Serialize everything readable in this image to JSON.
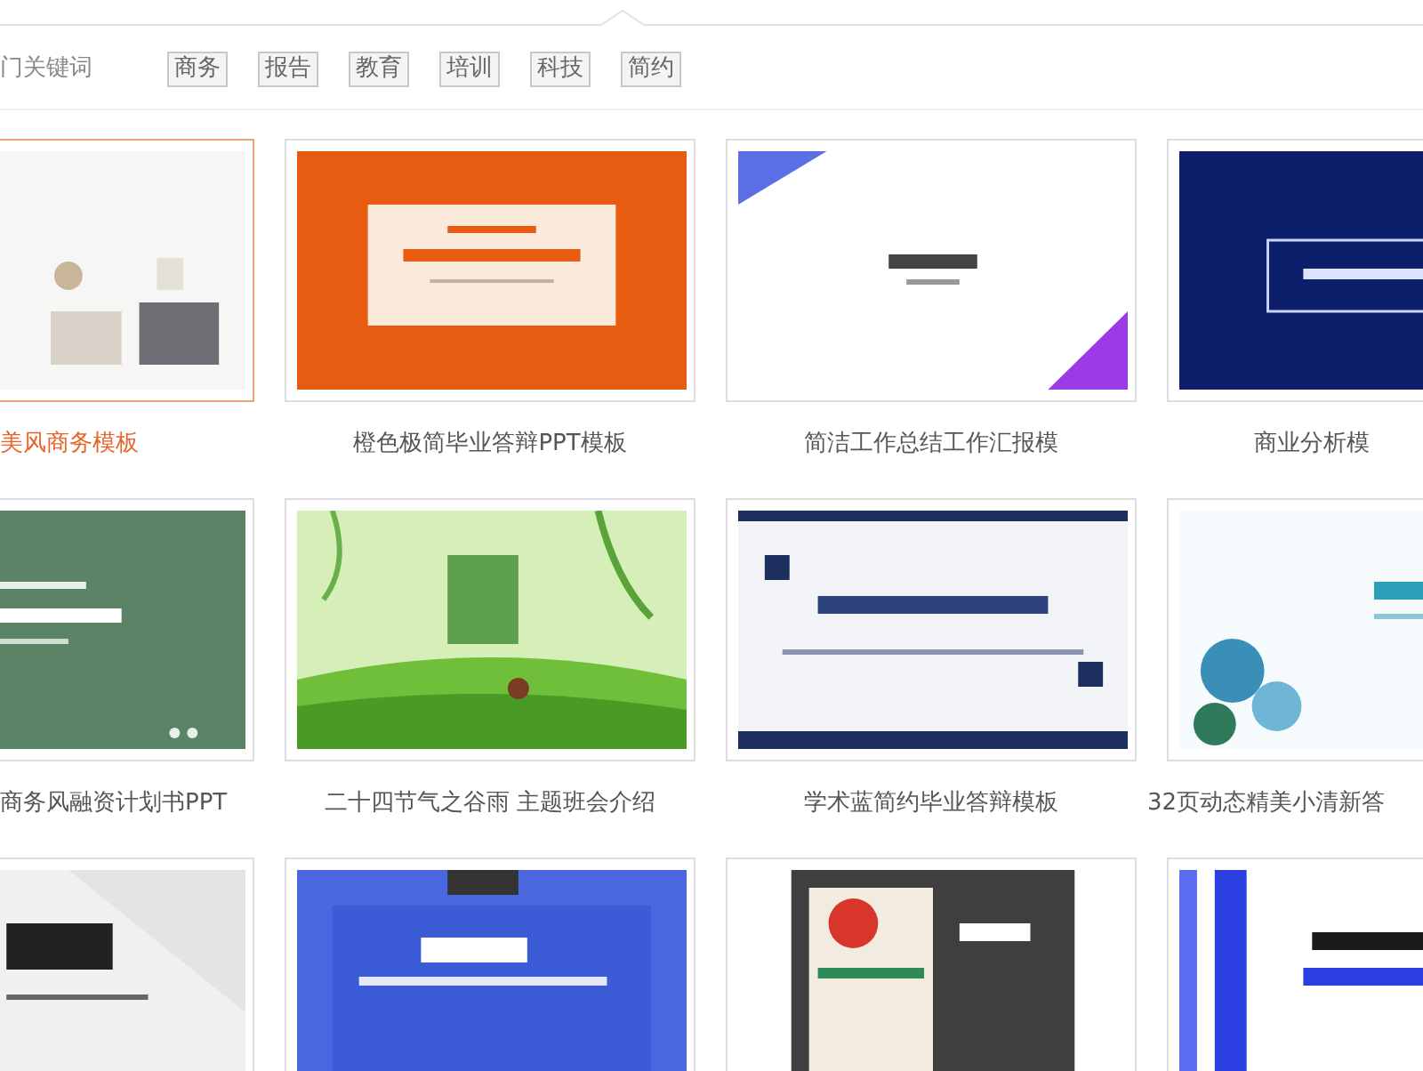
{
  "keywords": {
    "label": "门关键词",
    "tags": [
      "商务",
      "报告",
      "教育",
      "培训",
      "科技",
      "简约"
    ]
  },
  "templates": [
    {
      "caption": "美风商务模板",
      "selected": true
    },
    {
      "caption": "橙色极简毕业答辩PPT模板",
      "selected": false
    },
    {
      "caption": "简洁工作总结工作汇报模",
      "selected": false
    },
    {
      "caption": "商业分析模",
      "selected": false
    },
    {
      "caption": "商务风融资计划书PPT",
      "selected": false
    },
    {
      "caption": "二十四节气之谷雨 主题班会介绍",
      "selected": false
    },
    {
      "caption": "学术蓝简约毕业答辩模板",
      "selected": false
    },
    {
      "caption": "32页动态精美小清新答",
      "selected": false
    },
    {
      "selected": false
    },
    {
      "selected": false
    },
    {
      "selected": false
    },
    {
      "selected": false
    }
  ]
}
